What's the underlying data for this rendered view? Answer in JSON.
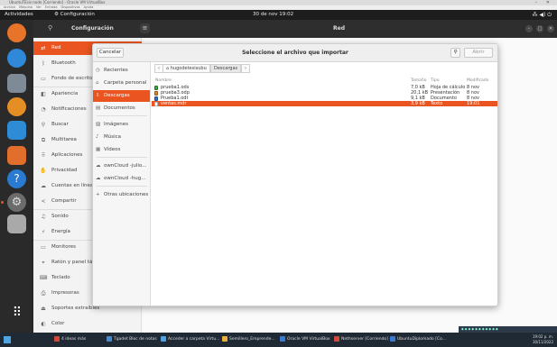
{
  "vbox": {
    "title": "UbuntuTEsis-node [Corriendo] - Oracle VM VirtualBox",
    "menu": [
      "Archivo",
      "Máquina",
      "Ver",
      "Entrada",
      "Dispositivos",
      "Ayuda"
    ]
  },
  "topbar": {
    "activities": "Actividades",
    "app": "Configuración",
    "clock": "30 de nov 19:02"
  },
  "settings": {
    "header_title": "Configuración",
    "page_title": "Red",
    "sidebar": [
      {
        "icon": "network-icon",
        "glyph": "⇄",
        "label": "Red"
      },
      {
        "icon": "bluetooth-icon",
        "glyph": "ᛒ",
        "label": "Bluetooth"
      },
      {
        "icon": "background-icon",
        "glyph": "▭",
        "label": "Fondo de escritorio"
      },
      {
        "icon": "appearance-icon",
        "glyph": "◧",
        "label": "Apariencia"
      },
      {
        "icon": "notifications-icon",
        "glyph": "◔",
        "label": "Notificaciones"
      },
      {
        "icon": "search-icon",
        "glyph": "⚲",
        "label": "Buscar"
      },
      {
        "icon": "multitasking-icon",
        "glyph": "⧉",
        "label": "Multitarea"
      },
      {
        "icon": "applications-icon",
        "glyph": "⠿",
        "label": "Aplicaciones"
      },
      {
        "icon": "privacy-icon",
        "glyph": "✋",
        "label": "Privacidad"
      },
      {
        "icon": "online-accounts-icon",
        "glyph": "☁",
        "label": "Cuentas en línea"
      },
      {
        "icon": "share-icon",
        "glyph": "<",
        "label": "Compartir"
      },
      {
        "icon": "sound-icon",
        "glyph": "♫",
        "label": "Sonido"
      },
      {
        "icon": "power-icon",
        "glyph": "⚡",
        "label": "Energía"
      },
      {
        "icon": "displays-icon",
        "glyph": "▭",
        "label": "Monitores"
      },
      {
        "icon": "mouse-icon",
        "glyph": "⌖",
        "label": "Ratón y panel táctil"
      },
      {
        "icon": "keyboard-icon",
        "glyph": "⌨",
        "label": "Teclado"
      },
      {
        "icon": "printers-icon",
        "glyph": "⎙",
        "label": "Impresoras"
      },
      {
        "icon": "removable-media-icon",
        "glyph": "⏏",
        "label": "Soportes extraíbles"
      },
      {
        "icon": "color-icon",
        "glyph": "◐",
        "label": "Color"
      }
    ]
  },
  "dialog": {
    "cancel": "Cancelar",
    "title": "Seleccione el archivo que importar",
    "open": "Abrir",
    "places": [
      {
        "icon": "recent-icon",
        "glyph": "◷",
        "label": "Recientes"
      },
      {
        "icon": "home-folder-icon",
        "glyph": "⌂",
        "label": "Carpeta personal"
      },
      {
        "icon": "downloads-folder-icon",
        "glyph": "⇩",
        "label": "Descargas"
      },
      {
        "icon": "documents-folder-icon",
        "glyph": "▤",
        "label": "Documentos"
      },
      {
        "icon": "pictures-folder-icon",
        "glyph": "▨",
        "label": "Imágenes"
      },
      {
        "icon": "music-folder-icon",
        "glyph": "♪",
        "label": "Música"
      },
      {
        "icon": "videos-folder-icon",
        "glyph": "▦",
        "label": "Vídeos"
      },
      {
        "icon": "cloud-drive-icon",
        "glyph": "☁",
        "label": "ownCloud -julio..."
      },
      {
        "icon": "cloud-drive-icon",
        "glyph": "☁",
        "label": "ownCloud -hug..."
      },
      {
        "icon": "other-locations-icon",
        "glyph": "+",
        "label": "Otras ubicaciones"
      }
    ],
    "path": [
      "hugodetesisubu",
      "Descargas"
    ],
    "columns": {
      "name": "Nombre",
      "size": "Tamaño",
      "type": "Tipo",
      "modified": "Modificado"
    },
    "files": [
      {
        "name": "prueba1.ods",
        "size": "7,0 kB",
        "type": "Hoja de cálculo",
        "modified": "8 nov",
        "color": "#3aa83a"
      },
      {
        "name": "prueba3.odp",
        "size": "20,1 kB",
        "type": "Presentación",
        "modified": "8 nov",
        "color": "#d9822b"
      },
      {
        "name": "Prueba1.odt",
        "size": "9,1 kB",
        "type": "Documento",
        "modified": "8 nov",
        "color": "#2f6fc0"
      },
      {
        "name": "ventas.mdr",
        "size": "3,9 kB",
        "type": "Texto",
        "modified": "19:01",
        "color": "#ffffff"
      }
    ]
  },
  "taskbar": {
    "items": [
      {
        "label": "4 ideas más",
        "color": "#d04a3a"
      },
      {
        "label": "Tgadet Bloc de notas",
        "color": "#4a88c8"
      },
      {
        "label": "Acceder a carpeta Virtu...",
        "color": "#4fa3e0"
      },
      {
        "label": "Semillero_Emprende...",
        "color": "#e8b03a"
      },
      {
        "label": "Oracle VM VirtualBox",
        "color": "#3a7ad0"
      },
      {
        "label": "Nethserver [Corriendo] -...",
        "color": "#d04a3a"
      },
      {
        "label": "UbuntuDiplomado [Co...",
        "color": "#3a7ad0"
      }
    ],
    "time": "19:02 p. m.",
    "date": "30/11/2022"
  }
}
